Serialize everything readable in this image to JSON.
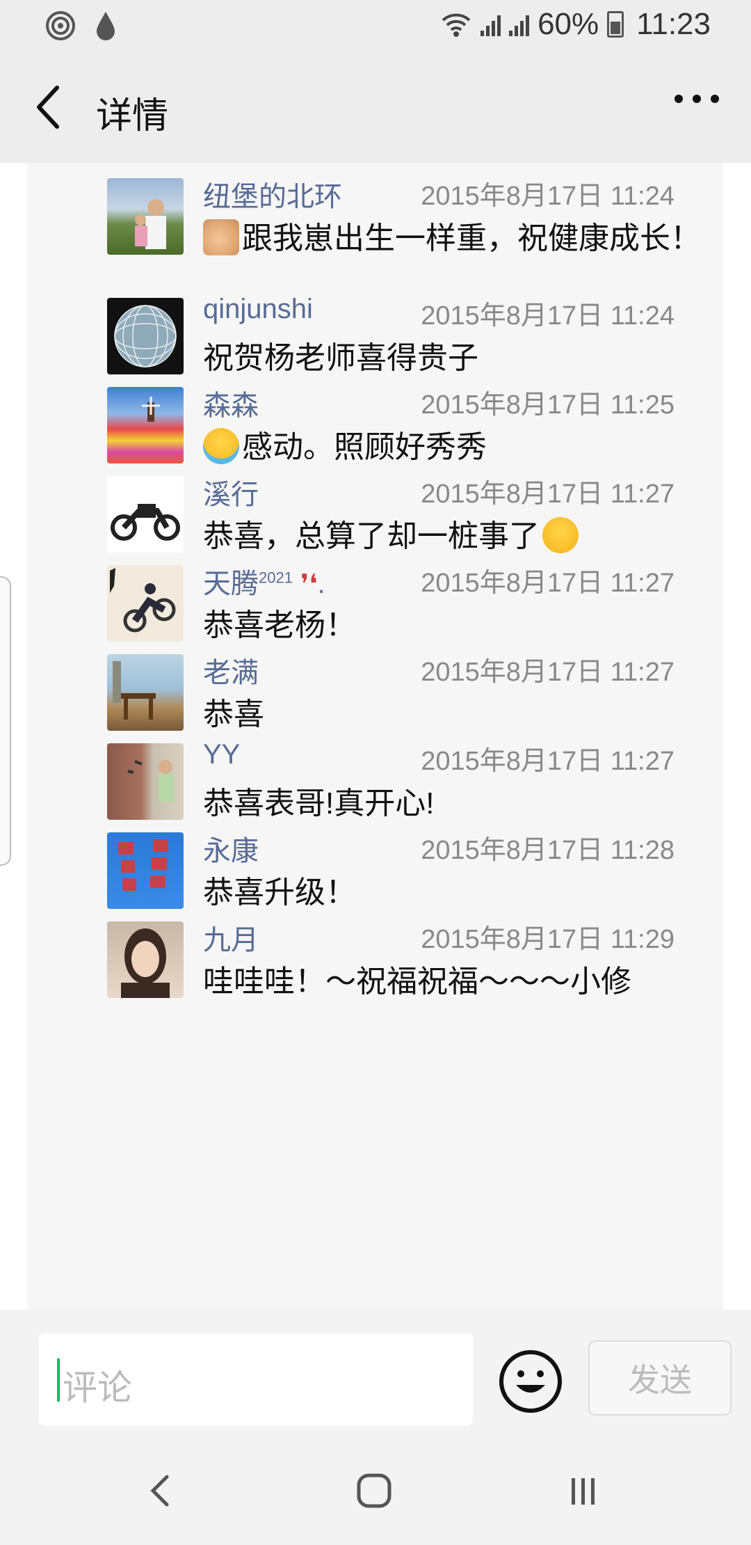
{
  "status_bar": {
    "battery_percent": "60%",
    "time": "11:23",
    "icons": [
      "nfc-icon",
      "drop-icon",
      "wifi-icon",
      "signal-icon",
      "signal-icon",
      "battery-icon"
    ]
  },
  "header": {
    "title": "详情",
    "back_icon": "chevron-left-icon",
    "more_icon": "more-dots-icon"
  },
  "comments": [
    {
      "name": "纽堡的北环",
      "time": "2015年8月17日 11:24",
      "text": "跟我崽出生一样重，祝健康成长！",
      "emoji": "thumbs-up",
      "avatar": "landscape-two-people"
    },
    {
      "name": "qinjunshi",
      "time": "2015年8月17日 11:24",
      "text": "祝贺杨老师喜得贵子",
      "emoji": "",
      "avatar": "geodesic-sphere"
    },
    {
      "name": "森森",
      "time": "2015年8月17日 11:25",
      "text": "感动。照顾好秀秀",
      "emoji": "crying-face",
      "avatar": "tulip-field-windmill"
    },
    {
      "name": "溪行",
      "time": "2015年8月17日 11:27",
      "text": "恭喜，总算了却一桩事了",
      "emoji_end": "grinning-face",
      "avatar": "motorcycle"
    },
    {
      "name": "天腾",
      "name_sup": "2021",
      "name_suffix": ".",
      "time": "2015年8月17日 11:27",
      "text": "恭喜老杨！",
      "emoji": "",
      "avatar": "motorbike-rider"
    },
    {
      "name": "老满",
      "time": "2015年8月17日 11:27",
      "text": "恭喜",
      "emoji": "",
      "avatar": "table-outdoor"
    },
    {
      "name": "YY",
      "time": "2015年8月17日 11:27",
      "text": "恭喜表哥!真开心!",
      "emoji": "",
      "avatar": "girl-with-birds"
    },
    {
      "name": "永康",
      "time": "2015年8月17日 11:28",
      "text": "恭喜升级！",
      "emoji": "",
      "avatar": "calligraphy-blue"
    },
    {
      "name": "九月",
      "time": "2015年8月17日 11:29",
      "text": "哇哇哇！～祝福祝福～～～小修",
      "emoji": "",
      "avatar": "woman-portrait"
    }
  ],
  "input_bar": {
    "placeholder": "评论",
    "emoji_icon": "smiley-icon",
    "send_label": "发送"
  },
  "nav_bar": {
    "back": "nav-back-icon",
    "home": "nav-home-icon",
    "recents": "nav-recents-icon"
  }
}
